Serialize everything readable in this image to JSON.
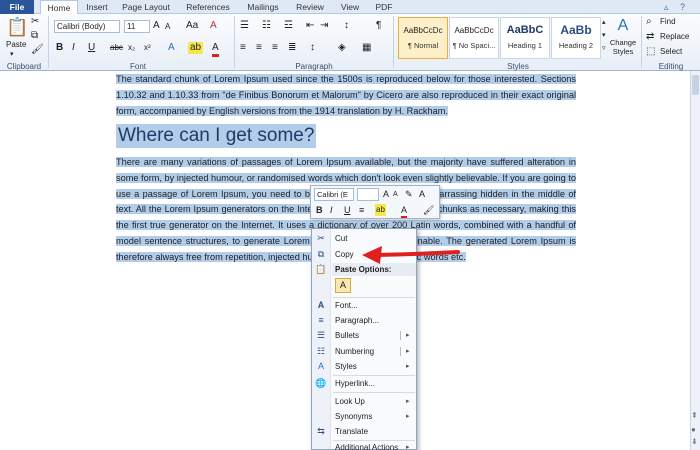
{
  "tabs": [
    {
      "label": "File"
    },
    {
      "label": "Home"
    },
    {
      "label": "Insert"
    },
    {
      "label": "Page Layout"
    },
    {
      "label": "References"
    },
    {
      "label": "Mailings"
    },
    {
      "label": "Review"
    },
    {
      "label": "View"
    },
    {
      "label": "PDF"
    }
  ],
  "ribbon": {
    "paste_label": "Paste",
    "clipboard_label": "Clipboard",
    "font_label": "Font",
    "paragraph_label": "Paragraph",
    "styles_label": "Styles",
    "editing_label": "Editing",
    "font_name": "Calibri (Body)",
    "font_size": "11",
    "styles": [
      {
        "sample": "AaBbCcDc",
        "name": "¶ Normal"
      },
      {
        "sample": "AaBbCcDc",
        "name": "¶ No Spaci..."
      },
      {
        "sample": "AaBbC",
        "name": "Heading 1"
      },
      {
        "sample": "AaBb",
        "name": "Heading 2"
      }
    ],
    "change_styles_label": "Change Styles",
    "find_label": "Find",
    "replace_label": "Replace",
    "select_label": "Select"
  },
  "document": {
    "para1": "The standard chunk of Lorem Ipsum used since the 1500s is reproduced below for those interested. Sections 1.10.32 and 1.10.33 from \"de Finibus Bonorum et Malorum\" by Cicero are also reproduced in their exact original form, accompanied by English versions from the 1914 translation by H. Rackham.",
    "heading": "Where can I get some?",
    "para2": "There are many variations of passages of Lorem Ipsum available, but the majority have suffered alteration in some form, by injected humour, or randomised words which don't look even slightly believable. If you are going to use a passage of Lorem Ipsum, you need to be sure there isn't anything embarrassing hidden in the middle of text. All the Lorem Ipsum generators on the Internet tend to repeat predefined chunks as necessary, making this the first true generator on the Internet. It uses a dictionary of over 200 Latin words, combined with a handful of model sentence structures, to generate Lorem Ipsum which looks reasonable. The generated Lorem Ipsum is therefore always free from repetition, injected humour, or non-characteristic words etc."
  },
  "mini_toolbar": {
    "font_name": "Calibri (E",
    "font_size": ""
  },
  "context_menu": {
    "items": [
      {
        "label": "Cut",
        "icon": "scissors-icon"
      },
      {
        "label": "Copy",
        "icon": "copy-icon"
      },
      {
        "label": "Paste Options:",
        "icon": "paste-icon"
      },
      {
        "label": "Font...",
        "icon": "font-icon"
      },
      {
        "label": "Paragraph...",
        "icon": "paragraph-icon"
      },
      {
        "label": "Bullets",
        "icon": "bullets-icon"
      },
      {
        "label": "Numbering",
        "icon": "numbering-icon"
      },
      {
        "label": "Styles",
        "icon": "styles-icon"
      },
      {
        "label": "Hyperlink...",
        "icon": "hyperlink-icon"
      },
      {
        "label": "Look Up",
        "icon": ""
      },
      {
        "label": "Synonyms",
        "icon": ""
      },
      {
        "label": "Translate",
        "icon": "translate-icon"
      },
      {
        "label": "Additional Actions",
        "icon": ""
      }
    ]
  },
  "colors": {
    "selection": "#b2cdea",
    "arrow": "#e0201e",
    "file_tab": "#2a5699"
  }
}
